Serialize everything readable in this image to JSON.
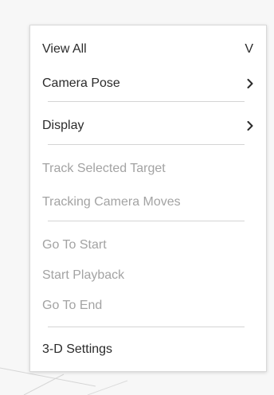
{
  "menu": {
    "items": [
      {
        "label": "View All",
        "shortcut": "V",
        "enabled": true
      },
      {
        "label": "Camera Pose",
        "submenu": true,
        "enabled": true
      },
      {
        "label": "Display",
        "submenu": true,
        "enabled": true
      },
      {
        "label": "Track Selected Target",
        "enabled": false
      },
      {
        "label": "Tracking Camera Moves",
        "enabled": false
      },
      {
        "label": "Go To Start",
        "enabled": false
      },
      {
        "label": "Start Playback",
        "enabled": false
      },
      {
        "label": "Go To End",
        "enabled": false
      },
      {
        "label": "3-D Settings",
        "enabled": true
      }
    ]
  },
  "colors": {
    "enabled_text": "#2b2b2b",
    "disabled_text": "#a3a3a3",
    "menu_background": "#ffffff",
    "separator": "#d4d4d4",
    "canvas_background": "#f7f7f7"
  }
}
